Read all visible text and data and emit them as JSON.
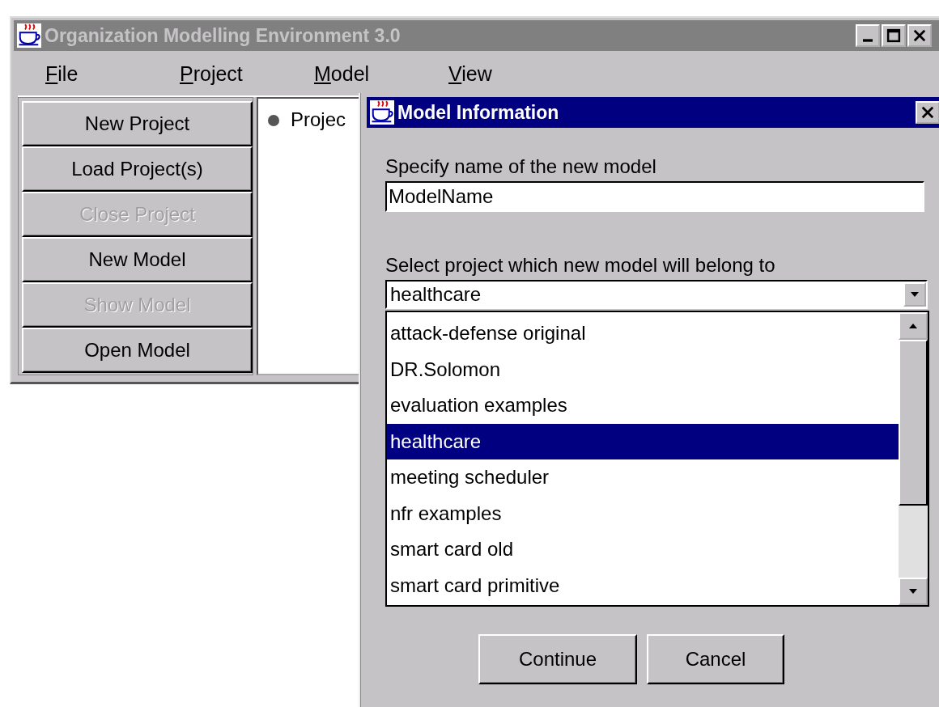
{
  "main_window": {
    "title": "Organization Modelling Environment 3.0"
  },
  "menu": [
    "File",
    "Project",
    "Model",
    "View"
  ],
  "side_buttons": [
    {
      "label": "New Project",
      "disabled": false
    },
    {
      "label": "Load Project(s)",
      "disabled": false
    },
    {
      "label": "Close Project",
      "disabled": true
    },
    {
      "label": "New Model",
      "disabled": false
    },
    {
      "label": "Show Model",
      "disabled": true
    },
    {
      "label": "Open Model",
      "disabled": false
    }
  ],
  "tree": {
    "items": [
      "Projec"
    ]
  },
  "dialog": {
    "title": "Model Information",
    "name_label": "Specify name of the new model",
    "name_value": "ModelName",
    "project_label": "Select project which new model will belong to",
    "combo_value": "healthcare",
    "list": [
      {
        "label": "attack-defense original",
        "selected": false
      },
      {
        "label": "DR.Solomon",
        "selected": false
      },
      {
        "label": "evaluation examples",
        "selected": false
      },
      {
        "label": "healthcare",
        "selected": true
      },
      {
        "label": "meeting scheduler",
        "selected": false
      },
      {
        "label": "nfr examples",
        "selected": false
      },
      {
        "label": "smart card old",
        "selected": false
      },
      {
        "label": "smart card primitive",
        "selected": false
      }
    ],
    "buttons": [
      "Continue",
      "Cancel"
    ]
  }
}
